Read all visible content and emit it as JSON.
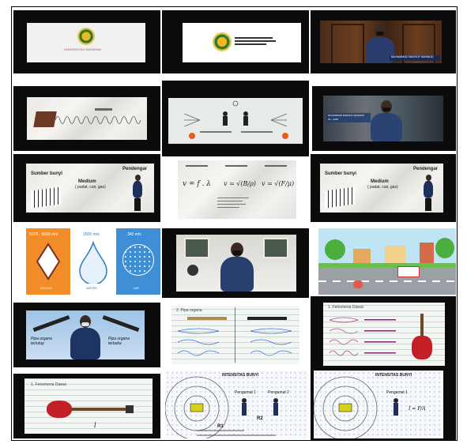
{
  "colors": {
    "frame": "#000000",
    "jacket": "#1d2f5a",
    "solid": "#f28c28",
    "water": "#2e7bc4",
    "air": "#3f8fd6",
    "guitar": "#c41f26"
  },
  "r1": {
    "c1": {
      "university": "UNIVERSITAS MATARAM"
    },
    "c3": {
      "name_caption": "MUHAMMAD MAKRUF MAHMUD"
    }
  },
  "r2": {
    "c3": {
      "caption_line1": "MUHAMMAD MAKRUF MAHMUD",
      "caption_line2": "S1 - 2019"
    }
  },
  "r3": {
    "c1": {
      "source": "Sumber bunyi",
      "medium": "Medium",
      "medium_sub": "( padat, cair, gas)",
      "listener": "Pendengar"
    },
    "c2": {
      "f1": "v = f . λ",
      "f2": "v = √(B/ρ)",
      "f3": "v = √(F/μ)"
    },
    "c3": {
      "source": "Sumber bunyi",
      "medium": "Medium",
      "medium_sub": "( padat, cair, gas)",
      "listener": "Pendengar"
    }
  },
  "r4": {
    "c1": {
      "solid_speed": "5120 - 5000 m/s",
      "water_speed": "1500 m/s",
      "air_speed": "340 m/s",
      "solid_label": "SOLIDS",
      "water_label": "WATER",
      "air_label": "AIR"
    }
  },
  "r5": {
    "c1": {
      "closed_pipe": "Pipa organa tertutup",
      "open_pipe": "Pipa organa terbuka"
    },
    "c2": {
      "heading": "2. Pipa organa"
    },
    "c3": {
      "heading": "1. Fenomena Dawai"
    }
  },
  "r6": {
    "c1": {
      "heading": "1. Fenomena Dawai",
      "length_symbol": "l"
    },
    "c2": {
      "title": "INTENSITAS BUNYI",
      "listener1": "Pengamat 1",
      "listener2": "Pengamat 2",
      "r1": "R1",
      "r2": "R2"
    },
    "c3": {
      "title": "INTENSITAS BUNYI",
      "listener1": "Pengamat 1",
      "formula": "I = P/A"
    }
  }
}
